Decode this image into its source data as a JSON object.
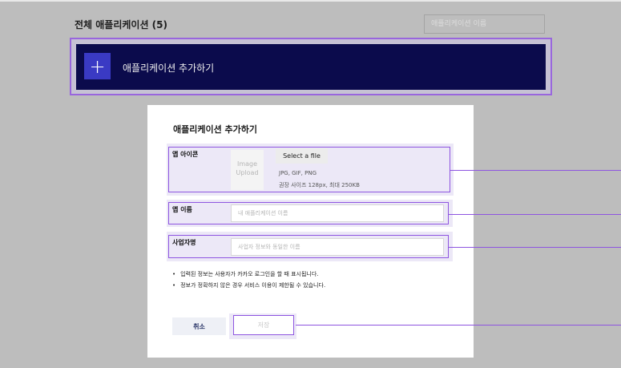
{
  "header": {
    "title": "전체 애플리케이션 (5)",
    "search_placeholder": "애플리케이션 이름"
  },
  "add_banner": {
    "icon": "+",
    "label": "애플리케이션 추가하기"
  },
  "modal": {
    "title": "애플리케이션 추가하기",
    "icon_field": {
      "label": "앱 아이콘",
      "upload_line1": "Image",
      "upload_line2": "Upload",
      "button_label": "Select a file",
      "hint_formats": "JPG, GIF, PNG",
      "hint_size": "권장 사이즈 128px, 최대 250KB"
    },
    "name_field": {
      "label": "앱 이름",
      "placeholder": "내 애플리케이션 이름"
    },
    "company_field": {
      "label": "사업자명",
      "placeholder": "사업자 정보와 동일한 이름"
    },
    "notes": [
      "입력된 정보는 사용자가 카카오 로그인을 할 때 표시됩니다.",
      "정보가 정확하지 않은 경우 서비스 이용이 제한될 수 있습니다."
    ],
    "cancel_label": "취소",
    "save_label": "저장"
  },
  "colors": {
    "overlay": "#bdbdbd",
    "banner": "#0b0b4c",
    "plus_tile": "#3a3ac4",
    "highlight": "#8e55e0"
  }
}
